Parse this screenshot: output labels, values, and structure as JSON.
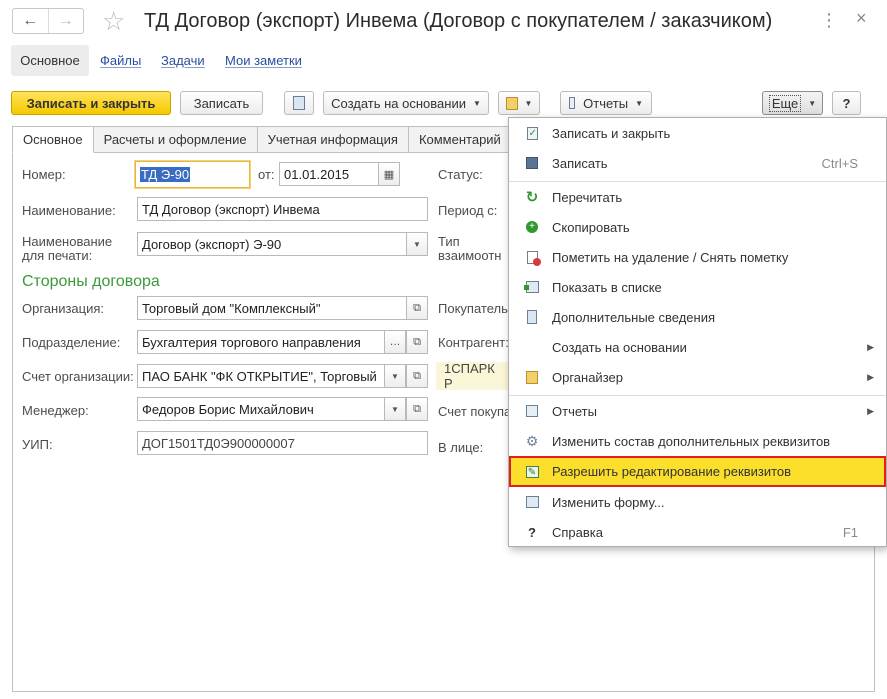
{
  "window": {
    "title": "ТД Договор (экспорт) Инвема (Договор с покупателем / заказчиком)",
    "back_icon": "arrow-left-icon",
    "forward_icon": "arrow-right-icon",
    "star_icon": "star-outline-icon",
    "menu_icon": "dots-menu-icon",
    "close_icon": "close-icon"
  },
  "section_nav": {
    "active": "Основное",
    "links": [
      "Файлы",
      "Задачи",
      "Мои заметки"
    ]
  },
  "toolbar": {
    "save_close": "Записать и закрыть",
    "save": "Записать",
    "create_based": "Создать на основании",
    "reports": "Отчеты",
    "more": "Еще",
    "help": "?"
  },
  "tabs": [
    "Основное",
    "Расчеты и оформление",
    "Учетная информация",
    "Комментарий"
  ],
  "fields": {
    "number_label": "Номер:",
    "number_value": "ТД Э-90",
    "date_label": "от:",
    "date_value": "01.01.2015",
    "status_label": "Статус:",
    "name_label": "Наименование:",
    "name_value": "ТД Договор (экспорт) Инвема",
    "period_label": "Период с:",
    "print_name_label_1": "Наименование",
    "print_name_label_2": "для печати:",
    "print_name_value": "Договор (экспорт) Э-90",
    "type_label_1": "Тип",
    "type_label_2": "взаимоотн",
    "parties_heading": "Стороны договора",
    "org_label": "Организация:",
    "org_value": "Торговый дом \"Комплексный\"",
    "buyer_label": "Покупатель",
    "dept_label": "Подразделение:",
    "dept_value": "Бухгалтерия торгового направления",
    "counterparty_label": "Контрагент:",
    "account_label": "Счет организации:",
    "account_value": "ПАО БАНК \"ФК ОТКРЫТИЕ\", Торговый",
    "spark_text": "1СПАРК Р",
    "manager_label": "Менеджер:",
    "manager_value": "Федоров Борис Михайлович",
    "buyer_account_label": "Счет покупа",
    "uip_label": "УИП:",
    "uip_value": "ДОГ1501ТД0Э900000007",
    "person_label": "В лице:"
  },
  "menu": {
    "items": [
      {
        "label": "Записать и закрыть",
        "icon": "save-close-icon",
        "shortcut": "",
        "submenu": false
      },
      {
        "label": "Записать",
        "icon": "floppy-disk-icon",
        "shortcut": "Ctrl+S",
        "submenu": false
      },
      {
        "label": "Перечитать",
        "icon": "refresh-icon",
        "shortcut": "",
        "submenu": false
      },
      {
        "label": "Скопировать",
        "icon": "copy-add-icon",
        "shortcut": "",
        "submenu": false
      },
      {
        "label": "Пометить на удаление / Снять пометку",
        "icon": "mark-delete-icon",
        "shortcut": "",
        "submenu": false
      },
      {
        "label": "Показать в списке",
        "icon": "show-in-list-icon",
        "shortcut": "",
        "submenu": false
      },
      {
        "label": "Дополнительные сведения",
        "icon": "additional-info-icon",
        "shortcut": "",
        "submenu": false
      },
      {
        "label": "Создать на основании",
        "icon": "",
        "shortcut": "",
        "submenu": true
      },
      {
        "label": "Органайзер",
        "icon": "organizer-icon",
        "shortcut": "",
        "submenu": true
      },
      {
        "label": "Отчеты",
        "icon": "reports-icon",
        "shortcut": "",
        "submenu": true
      },
      {
        "label": "Изменить состав дополнительных реквизитов",
        "icon": "gear-attributes-icon",
        "shortcut": "",
        "submenu": false
      },
      {
        "label": "Разрешить редактирование реквизитов",
        "icon": "pencil-edit-icon",
        "shortcut": "",
        "submenu": false
      },
      {
        "label": "Изменить форму...",
        "icon": "change-form-icon",
        "shortcut": "",
        "submenu": false
      },
      {
        "label": "Справка",
        "icon": "question-icon",
        "shortcut": "F1",
        "submenu": false
      }
    ],
    "highlighted_index": 11,
    "highlight_color": "#fbdf2a",
    "highlight_border_color": "#e02020"
  },
  "colors": {
    "primary_button": "#f6c800",
    "section_heading": "#3a9a3a",
    "link": "#2a4f9e",
    "selection": "#3a6cc1"
  }
}
